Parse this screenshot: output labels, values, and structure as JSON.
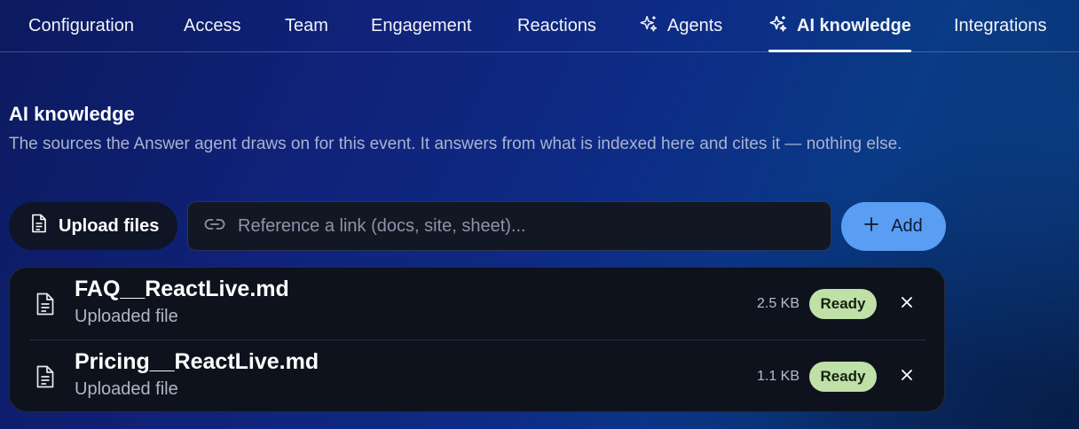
{
  "tabs": [
    {
      "label": "Configuration",
      "icon": null
    },
    {
      "label": "Access",
      "icon": null
    },
    {
      "label": "Team",
      "icon": null
    },
    {
      "label": "Engagement",
      "icon": null
    },
    {
      "label": "Reactions",
      "icon": null
    },
    {
      "label": "Agents",
      "icon": "sparkles-icon"
    },
    {
      "label": "AI knowledge",
      "icon": "sparkles-icon",
      "active": true
    },
    {
      "label": "Integrations",
      "icon": null
    }
  ],
  "section": {
    "title": "AI knowledge",
    "description": "The sources the Answer agent draws on for this event. It answers from what is indexed here and cites it — nothing else."
  },
  "toolbar": {
    "upload_label": "Upload files",
    "link_placeholder": "Reference a link (docs, site, sheet)...",
    "link_value": "",
    "add_label": "Add"
  },
  "files": [
    {
      "name": "FAQ__ReactLive.md",
      "source": "Uploaded file",
      "size": "2.5 KB",
      "status": "Ready"
    },
    {
      "name": "Pricing__ReactLive.md",
      "source": "Uploaded file",
      "size": "1.1 KB",
      "status": "Ready"
    }
  ],
  "colors": {
    "accent": "#5a9ef4",
    "status_ready": "#bfe0a6",
    "panel": "#0e121d"
  }
}
